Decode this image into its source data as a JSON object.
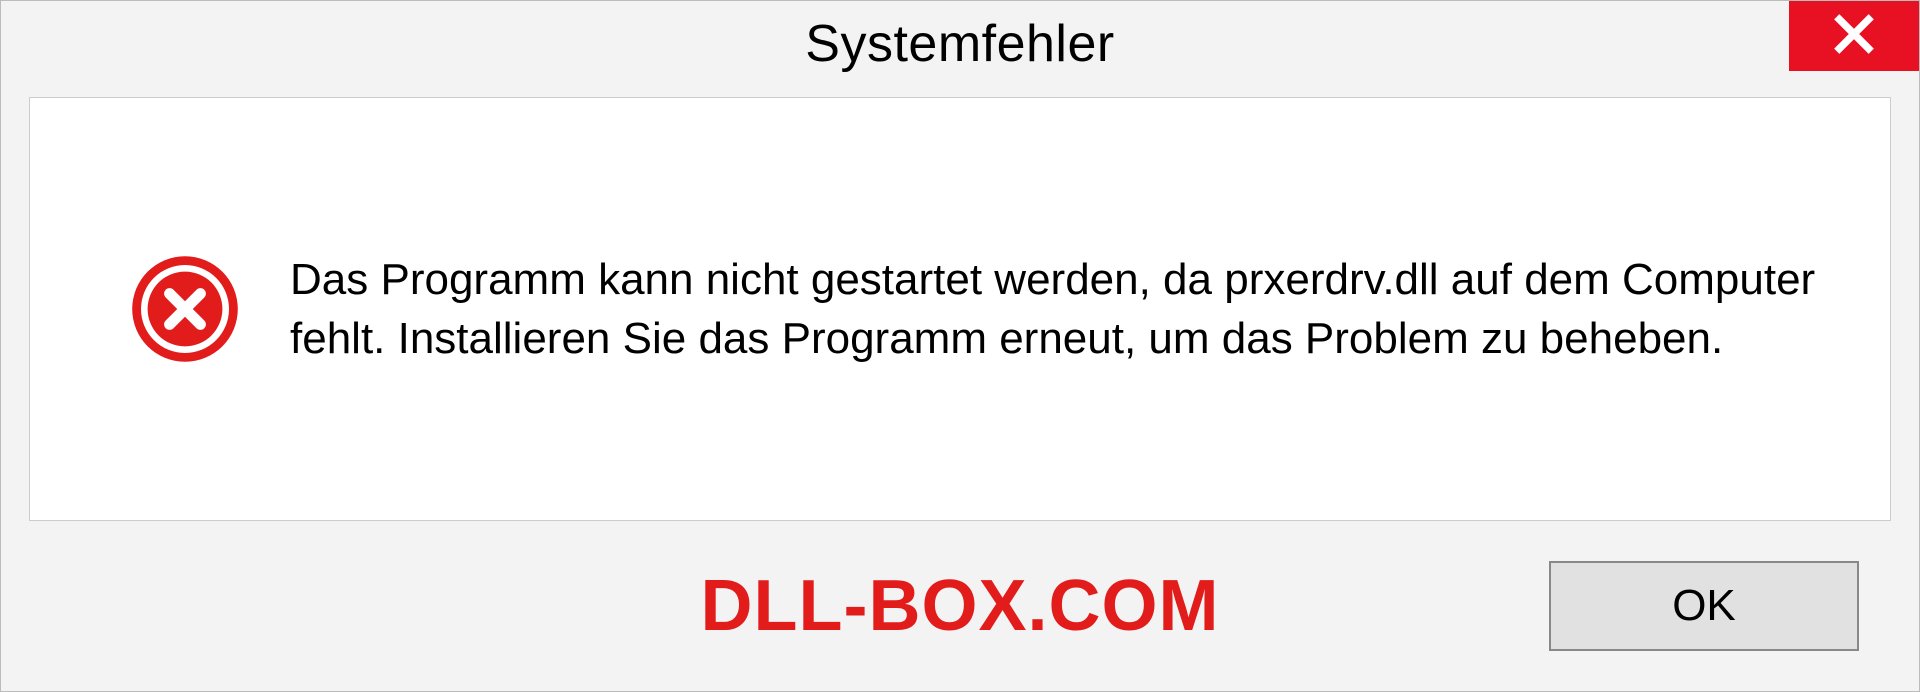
{
  "dialog": {
    "title": "Systemfehler",
    "message": "Das Programm kann nicht gestartet werden, da prxerdrv.dll auf dem Computer fehlt. Installieren Sie das Programm erneut, um das Problem zu beheben.",
    "ok_label": "OK"
  },
  "watermark": "DLL-BOX.COM",
  "colors": {
    "close_bg": "#e81123",
    "error_icon": "#e21b1b",
    "watermark": "#e21b1b"
  }
}
